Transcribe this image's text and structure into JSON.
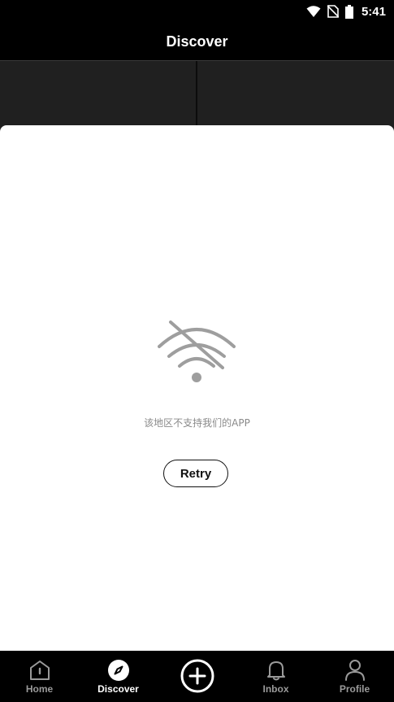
{
  "status_bar": {
    "time": "5:41",
    "icons": [
      "wifi-icon",
      "no-sim-icon",
      "battery-icon"
    ]
  },
  "header": {
    "title": "Discover"
  },
  "empty_state": {
    "icon": "no-wifi-icon",
    "message": "该地区不支持我们的APP",
    "retry_label": "Retry"
  },
  "tabbar": {
    "items": [
      {
        "label": "Home",
        "icon": "home-icon",
        "active": false
      },
      {
        "label": "Discover",
        "icon": "compass-icon",
        "active": true
      },
      {
        "label": "",
        "icon": "plus-icon",
        "active": false
      },
      {
        "label": "Inbox",
        "icon": "bell-icon",
        "active": false
      },
      {
        "label": "Profile",
        "icon": "person-icon",
        "active": false
      }
    ]
  },
  "colors": {
    "background": "#000000",
    "sheet": "#ffffff",
    "muted_text": "#8a8a8a",
    "icon_gray": "#9e9e9e"
  }
}
